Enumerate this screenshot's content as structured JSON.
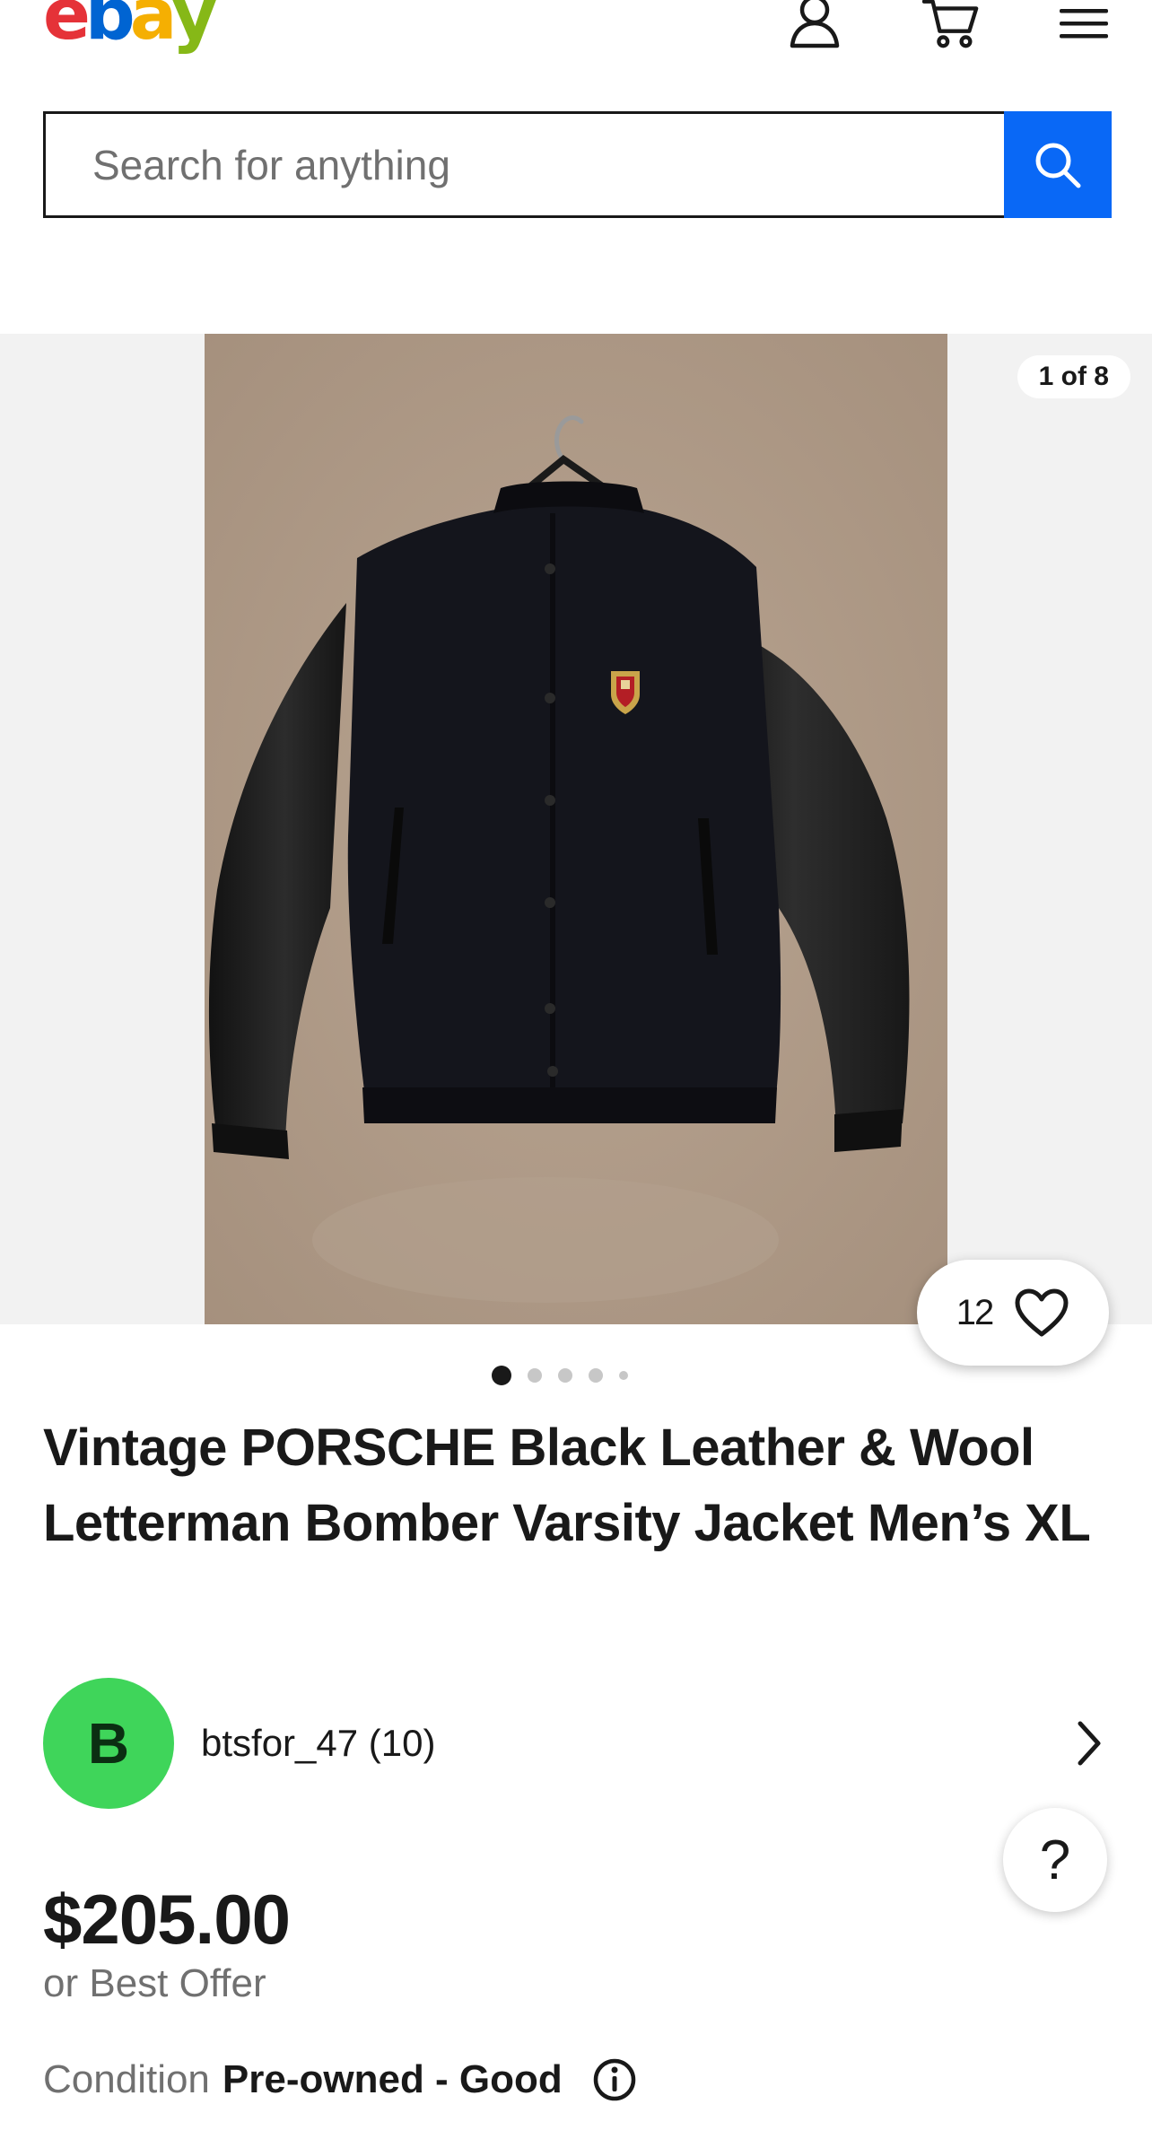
{
  "brand": {
    "letters": [
      {
        "char": "e",
        "color": "#e53238"
      },
      {
        "char": "b",
        "color": "#0064d2"
      },
      {
        "char": "a",
        "color": "#f5af02"
      },
      {
        "char": "y",
        "color": "#86b817"
      }
    ],
    "accent": "#0968f6"
  },
  "header": {
    "icons": [
      "account-icon",
      "cart-icon",
      "menu-icon"
    ]
  },
  "search": {
    "placeholder": "Search for anything",
    "value": ""
  },
  "gallery": {
    "counter": "1 of 8",
    "current_index": 1,
    "total": 8,
    "watch_count": "12"
  },
  "listing": {
    "title": "Vintage PORSCHE Black Leather & Wool Letterman Bomber Varsity Jacket Men’s XL",
    "seller_initial": "B",
    "seller": "btsfor_47 (10)",
    "price": "$205.00",
    "offer": "or Best Offer",
    "condition_label": "Condition",
    "condition_value": "Pre-owned - Good"
  },
  "help": {
    "label": "?"
  }
}
